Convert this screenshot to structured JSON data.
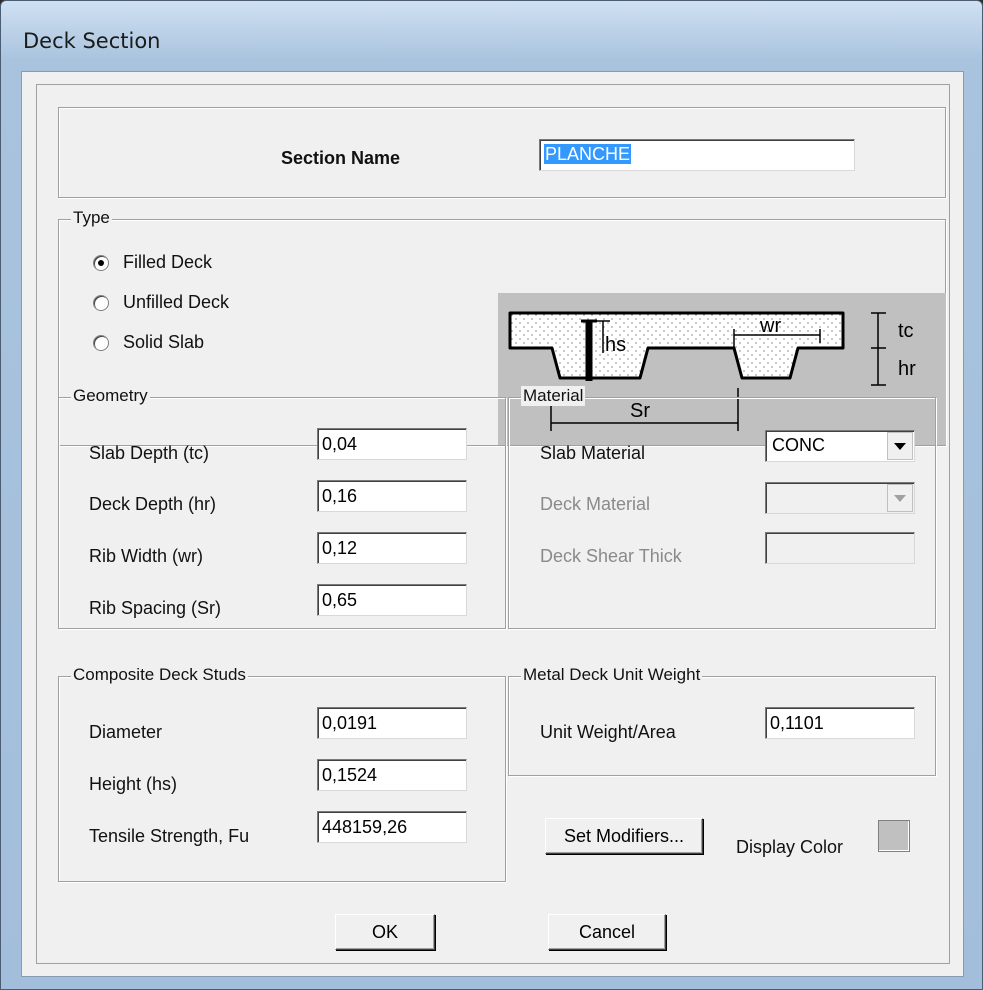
{
  "window": {
    "title": "Deck Section"
  },
  "section_name": {
    "label": "Section Name",
    "value": "PLANCHE"
  },
  "type": {
    "legend": "Type",
    "options": [
      "Filled Deck",
      "Unfilled Deck",
      "Solid Slab"
    ],
    "selected": "Filled Deck"
  },
  "diagram": {
    "labels": {
      "hs": "hs",
      "wr": "wr",
      "tc": "tc",
      "hr": "hr",
      "sr": "Sr"
    }
  },
  "geometry": {
    "legend": "Geometry",
    "fields": [
      {
        "label": "Slab Depth (tc)",
        "value": "0,04"
      },
      {
        "label": "Deck Depth (hr)",
        "value": "0,16"
      },
      {
        "label": "Rib Width (wr)",
        "value": "0,12"
      },
      {
        "label": "Rib Spacing (Sr)",
        "value": "0,65"
      }
    ]
  },
  "material": {
    "legend": "Material",
    "slab_material": {
      "label": "Slab Material",
      "value": "CONC"
    },
    "deck_material": {
      "label": "Deck Material",
      "value": ""
    },
    "deck_shear_thick": {
      "label": "Deck Shear Thick",
      "value": ""
    }
  },
  "studs": {
    "legend": "Composite Deck Studs",
    "fields": [
      {
        "label": "Diameter",
        "value": "0,0191"
      },
      {
        "label": "Height (hs)",
        "value": "0,1524"
      },
      {
        "label": "Tensile Strength, Fu",
        "value": "448159,26"
      }
    ]
  },
  "unit_weight": {
    "legend": "Metal Deck Unit Weight",
    "label": "Unit Weight/Area",
    "value": "0,1101"
  },
  "buttons": {
    "set_modifiers": "Set Modifiers...",
    "ok": "OK",
    "cancel": "Cancel"
  },
  "display_color": {
    "label": "Display Color",
    "color": "#c0c0c0"
  }
}
